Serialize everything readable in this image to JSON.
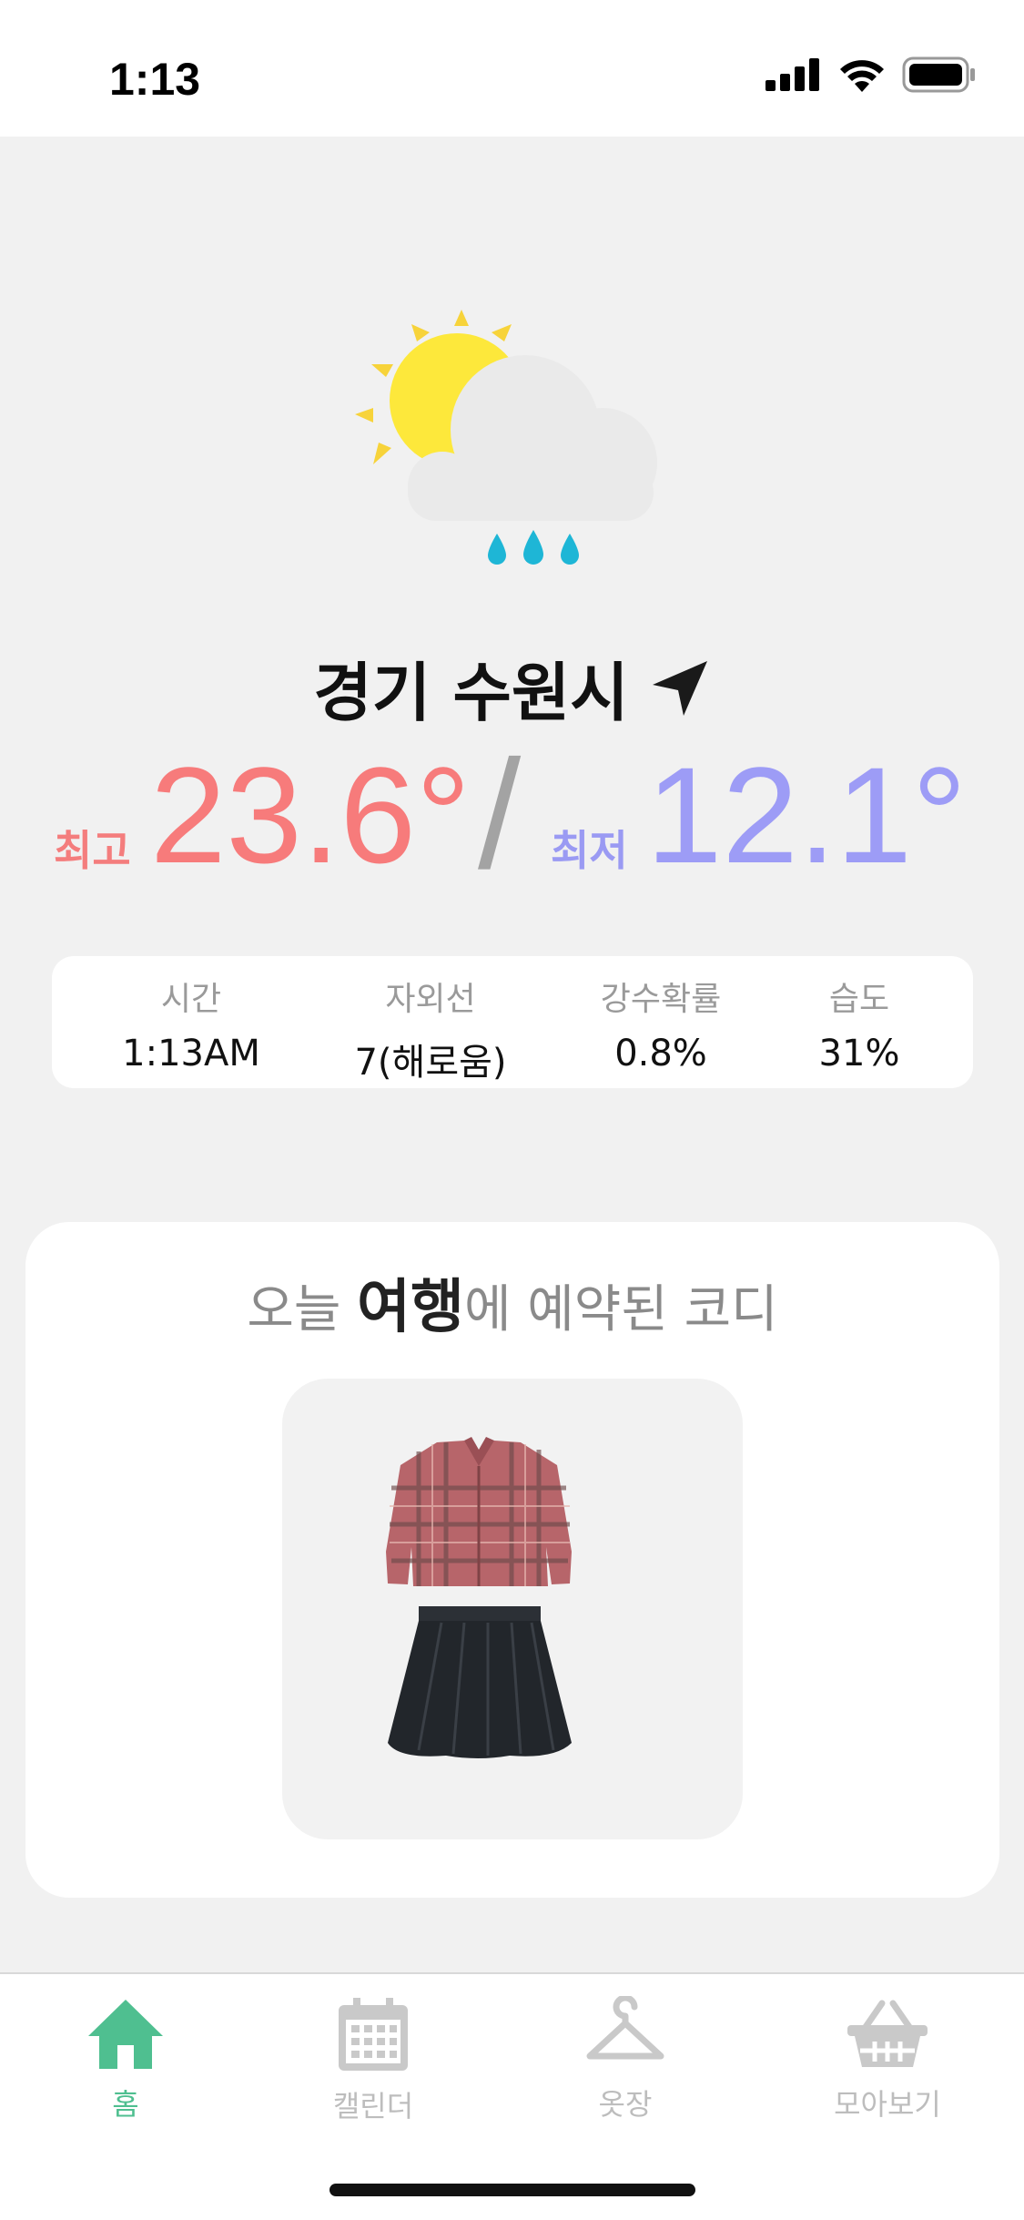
{
  "status": {
    "time": "1:13"
  },
  "weather": {
    "location": "경기 수원시",
    "high_label": "최고",
    "high_value": "23.6°",
    "separator": "/",
    "low_label": "최저",
    "low_value": "12.1°",
    "details": [
      {
        "label": "시간",
        "value": "1:13AM"
      },
      {
        "label": "자외선",
        "value": "7(해로움)"
      },
      {
        "label": "강수확률",
        "value": "0.8%"
      },
      {
        "label": "습도",
        "value": "31%"
      }
    ]
  },
  "outfit": {
    "title_prefix": "오늘 ",
    "title_highlight": "여행",
    "title_suffix": "에 예약된 코디"
  },
  "tabs": [
    {
      "label": "홈",
      "icon": "home-icon",
      "active": true
    },
    {
      "label": "캘린더",
      "icon": "calendar-icon",
      "active": false
    },
    {
      "label": "옷장",
      "icon": "hanger-icon",
      "active": false
    },
    {
      "label": "모아보기",
      "icon": "basket-icon",
      "active": false
    }
  ],
  "colors": {
    "high": "#f77b7b",
    "low": "#9d9cf6",
    "accent": "#4fbf90",
    "inactive": "#bdbdbd"
  }
}
